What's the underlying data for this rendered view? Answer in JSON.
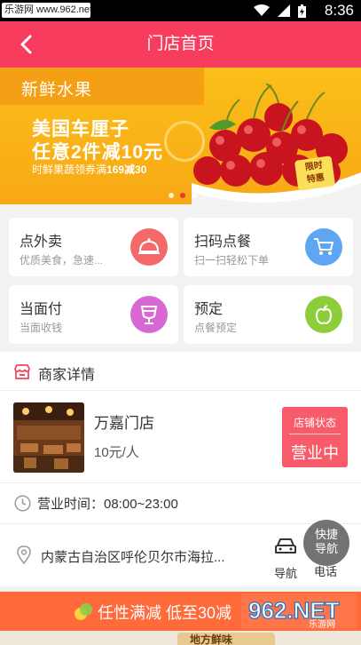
{
  "status_bar": {
    "watermark": "乐游网 www.962.net",
    "time": "8:36"
  },
  "header": {
    "title": "门店首页"
  },
  "banner": {
    "heading": "新鲜水果",
    "line1": "美国车厘子",
    "line2": "任意2件减10元",
    "line3_prefix": "时鲜果蔬领券满",
    "line3_bold": "169减30",
    "tag_line1": "限时",
    "tag_line2": "特惠",
    "slides": 3,
    "active_slide": 2
  },
  "services": [
    {
      "title": "点外卖",
      "subtitle": "优质美食，急速...",
      "icon": "cloche-icon",
      "color": "#f46a6a"
    },
    {
      "title": "扫码点餐",
      "subtitle": "扫一扫轻松下单",
      "icon": "cart-icon",
      "color": "#5ea6f2"
    },
    {
      "title": "当面付",
      "subtitle": "当面收钱",
      "icon": "cup-icon",
      "color": "#d868d4"
    },
    {
      "title": "预定",
      "subtitle": "点餐预定",
      "icon": "apple-icon",
      "color": "#8dcd3a"
    }
  ],
  "merchant": {
    "section_title": "商家详情",
    "name": "万嘉门店",
    "price": "10元/人",
    "status_label": "店铺状态",
    "status_value": "营业中",
    "hours": "营业时间：08:00~23:00",
    "address": "内蒙古自治区呼伦贝尔市海拉...",
    "nav_label": "导航",
    "call_label": "电话",
    "fab_line1": "快捷",
    "fab_line2": "导航"
  },
  "promo": {
    "text": "任性满减 低至30减",
    "watermark_main": "962.NET",
    "watermark_sub": "乐游网"
  },
  "bottom_strip": {
    "text": "地方鲜味"
  }
}
